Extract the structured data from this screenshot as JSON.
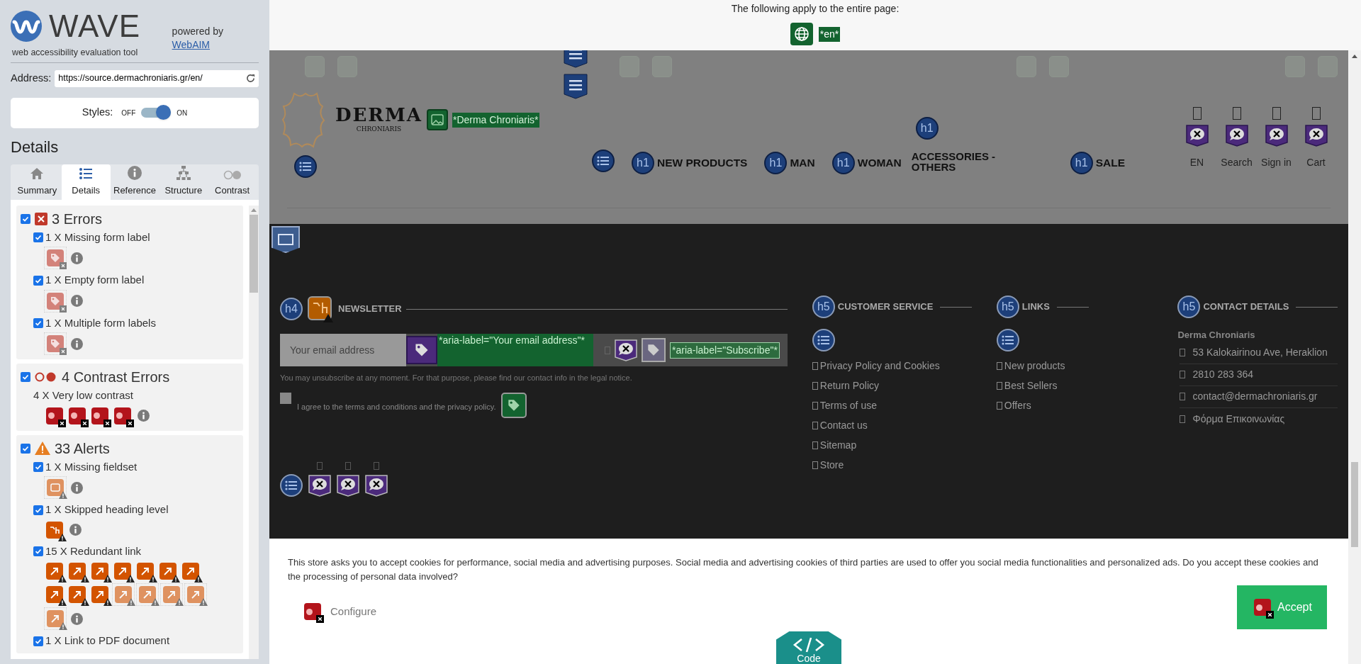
{
  "wave": {
    "title": "WAVE",
    "subtitle": "web accessibility evaluation tool",
    "powered_by": "powered by",
    "link": "WebAIM",
    "address_label": "Address:",
    "address": "https://source.dermachroniaris.gr/en/",
    "styles_label": "Styles:",
    "styles_off": "OFF",
    "styles_on": "ON",
    "styles_enabled": true,
    "heading": "Details"
  },
  "tabs": [
    {
      "label": "Summary",
      "selected": false
    },
    {
      "label": "Details",
      "selected": true
    },
    {
      "label": "Reference",
      "selected": false
    },
    {
      "label": "Structure",
      "selected": false
    },
    {
      "label": "Contrast",
      "selected": false
    }
  ],
  "sections": [
    {
      "kind": "error",
      "title": "3 Errors",
      "checked": true,
      "items": [
        {
          "label": "1 X Missing form label",
          "checked": true,
          "kind": "label",
          "markers": [
            {
              "dimmed": true
            }
          ]
        },
        {
          "label": "1 X Empty form label",
          "checked": true,
          "kind": "label",
          "markers": [
            {
              "dimmed": true
            }
          ]
        },
        {
          "label": "1 X Multiple form labels",
          "checked": true,
          "kind": "label",
          "markers": [
            {
              "dimmed": true
            }
          ]
        }
      ]
    },
    {
      "kind": "contrast",
      "title": "4 Contrast Errors",
      "checked": true,
      "items": [
        {
          "label": "4 X Very low contrast",
          "kind": "contrast",
          "markers": [
            {
              "dimmed": false
            },
            {
              "dimmed": false
            },
            {
              "dimmed": false
            },
            {
              "dimmed": false
            }
          ]
        }
      ]
    },
    {
      "kind": "alert",
      "title": "33 Alerts",
      "checked": true,
      "items": [
        {
          "label": "1 X Missing fieldset",
          "checked": true,
          "kind": "fieldset",
          "markers": [
            {
              "dimmed": true
            }
          ]
        },
        {
          "label": "1 X Skipped heading level",
          "checked": true,
          "kind": "heading",
          "markers": [
            {
              "dimmed": false
            }
          ]
        },
        {
          "label": "15 X Redundant link",
          "checked": true,
          "kind": "link",
          "markers": [
            {
              "dimmed": false
            },
            {
              "dimmed": false
            },
            {
              "dimmed": false
            },
            {
              "dimmed": false
            },
            {
              "dimmed": false
            },
            {
              "dimmed": false
            },
            {
              "dimmed": false
            },
            {
              "dimmed": false
            },
            {
              "dimmed": false
            },
            {
              "dimmed": false
            },
            {
              "dimmed": true
            },
            {
              "dimmed": true
            },
            {
              "dimmed": true
            },
            {
              "dimmed": true
            },
            {
              "dimmed": true
            }
          ]
        },
        {
          "label": "1 X Link to PDF document",
          "checked": true
        }
      ]
    }
  ],
  "page_notice": {
    "text": "The following apply to the entire page:",
    "language": "*en*"
  },
  "header": {
    "logo_word": "DERMA",
    "logo_sub": "CHRONIARIS",
    "logo_alt": "*Derma Chroniaris*",
    "nav": [
      {
        "label": "NEW PRODUCTS",
        "badge": "h1",
        "kind": "inline"
      },
      {
        "label": "MAN",
        "badge": "h1",
        "kind": "inline"
      },
      {
        "label": "WOMAN",
        "badge": "h1",
        "kind": "inline"
      },
      {
        "label": "ACCESSORIES - OTHERS",
        "badge": "h1",
        "kind": "stacked"
      },
      {
        "label": "SALE",
        "badge": "h1",
        "kind": "inline"
      }
    ],
    "utilities": [
      "EN",
      "Search",
      "Sign in",
      "Cart"
    ]
  },
  "footer": {
    "newsletter": {
      "badge": "h4",
      "heading": "NEWSLETTER",
      "placeholder": "Your email address",
      "field_label": "*aria-label=\"Your email address\"*",
      "button_label": "*aria-label=\"Subscribe\"*",
      "note": "You may unsubscribe at any moment. For that purpose, please find our contact info in the legal notice.",
      "agree": "I agree to the terms and conditions and the privacy policy.",
      "agree_checked": false
    },
    "columns": [
      {
        "badge": "h5",
        "heading": "CUSTOMER SERVICE",
        "links": [
          "Privacy Policy and Cookies",
          "Return Policy",
          "Terms of use",
          "Contact us",
          "Sitemap",
          "Store"
        ]
      },
      {
        "badge": "h5",
        "heading": "LINKS",
        "links": [
          "New products",
          "Best Sellers",
          "Offers"
        ]
      }
    ],
    "contact": {
      "badge": "h5",
      "heading": "CONTACT DETAILS",
      "name": "Derma Chroniaris",
      "items": [
        "53 Kalokairinou Ave, Heraklion",
        "2810 283 364",
        "contact@dermachroniaris.gr",
        "Φόρμα Επικοινωνίας"
      ]
    }
  },
  "cookies": {
    "text": "This store asks you to accept cookies for performance, social media and advertising purposes. Social media and advertising cookies of third parties are used to offer you social media functionalities and personalized ads. Do you accept these cookies and the processing of personal data involved?",
    "configure": "Configure",
    "accept": "Accept"
  },
  "code_tab": "Code"
}
